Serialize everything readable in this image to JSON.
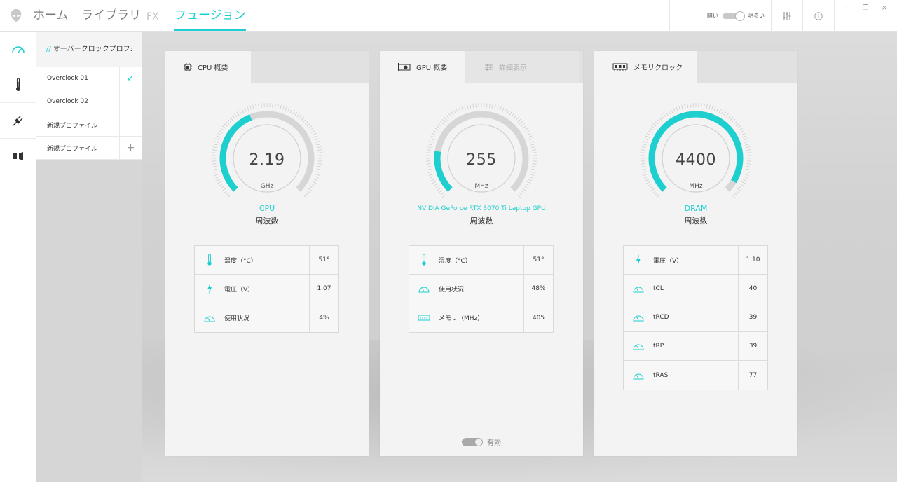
{
  "app": {
    "nav": [
      {
        "label": "ホーム",
        "state": "normal"
      },
      {
        "label": "ライブラリ",
        "state": "normal"
      },
      {
        "label": "FX",
        "state": "disabled"
      },
      {
        "label": "フュージョン",
        "state": "active"
      }
    ],
    "brightness": {
      "dark_label": "暗い",
      "bright_label": "明るい"
    },
    "window": {
      "minimize": "—",
      "restore": "❐",
      "close": "×"
    }
  },
  "colors": {
    "accent": "#1ecfcf",
    "track": "#d6d6d6"
  },
  "rail": [
    {
      "icon": "overclock-gauge-icon"
    },
    {
      "icon": "thermometer-icon"
    },
    {
      "icon": "power-plug-icon"
    },
    {
      "icon": "audio-icon"
    }
  ],
  "profiles": {
    "header": "オーバークロックプロフ:",
    "header_prefix": "//",
    "items": [
      {
        "name": "Overclock 01",
        "action": "✓"
      },
      {
        "name": "Overclock 02",
        "action": ""
      },
      {
        "name": "新規プロファイル",
        "action": ""
      },
      {
        "name": "新規プロファイル",
        "action": "+"
      }
    ]
  },
  "cards": [
    {
      "tabs": [
        {
          "label": "CPU 概要",
          "icon": "cpu-chip-icon"
        }
      ],
      "gauge": {
        "value": "2.19",
        "unit": "GHz",
        "name": "CPU",
        "sub": "周波数",
        "level": 0.42
      },
      "stats": [
        {
          "icon": "thermometer-icon",
          "label": "温度（°C）",
          "value": "51°"
        },
        {
          "icon": "lightning-icon",
          "label": "電圧（V）",
          "value": "1.07"
        },
        {
          "icon": "speedometer-icon",
          "label": "使用状況",
          "value": "4%"
        }
      ]
    },
    {
      "tabs": [
        {
          "label": "GPU 概要",
          "icon": "gpu-card-icon"
        },
        {
          "label": "詳細表示",
          "icon": "sliders-icon"
        }
      ],
      "gauge": {
        "value": "255",
        "unit": "MHz",
        "name": "NVIDIA GeForce RTX 3070 Ti Laptop GPU",
        "sub": "周波数",
        "level": 0.2
      },
      "stats": [
        {
          "icon": "thermometer-icon",
          "label": "温度（°C）",
          "value": "51°"
        },
        {
          "icon": "speedometer-icon",
          "label": "使用状況",
          "value": "48%"
        },
        {
          "icon": "memory-icon",
          "label": "メモリ（MHz）",
          "value": "405"
        }
      ],
      "enable_label": "有効"
    },
    {
      "tabs": [
        {
          "label": "メモリクロック",
          "icon": "ram-stick-icon"
        }
      ],
      "gauge": {
        "value": "4400",
        "unit": "MHz",
        "name": "DRAM",
        "sub": "周波数",
        "level": 0.95
      },
      "stats": [
        {
          "icon": "lightning-icon",
          "label": "電圧（V）",
          "value": "1.10"
        },
        {
          "icon": "speedometer-icon",
          "label": "tCL",
          "value": "40"
        },
        {
          "icon": "speedometer-icon",
          "label": "tRCD",
          "value": "39"
        },
        {
          "icon": "speedometer-icon",
          "label": "tRP",
          "value": "39"
        },
        {
          "icon": "speedometer-icon",
          "label": "tRAS",
          "value": "77"
        }
      ]
    }
  ]
}
